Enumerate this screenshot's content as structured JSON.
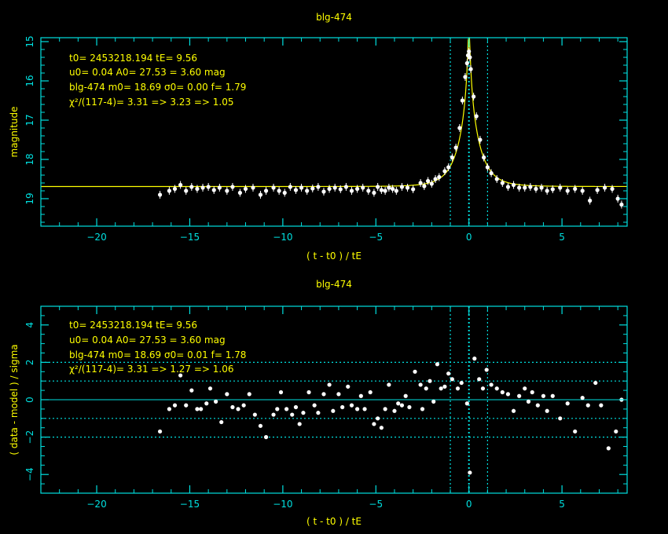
{
  "colors": {
    "axis": "#00e0e0",
    "text": "#ffff00",
    "model": "#ffff00",
    "points": "#ffffff",
    "background": "#000000"
  },
  "chart_data": [
    {
      "type": "scatter",
      "title": "blg-474",
      "xlabel": "( t - t0 ) / tE",
      "ylabel": "magnitude",
      "xlim": [
        -23,
        8.5
      ],
      "ylim": [
        19.7,
        14.9
      ],
      "y_inverted": true,
      "xticks": [
        -20,
        -15,
        -10,
        -5,
        0,
        5
      ],
      "yticks": [
        15,
        16,
        17,
        18,
        19
      ],
      "vlines_dotted": [
        -1,
        0,
        1
      ],
      "annotations": [
        "t0= 2453218.194 tE= 9.56",
        "u0= 0.04 A0= 27.53 = 3.60 mag",
        "blg-474 m0= 18.69 σ0= 0.00 f= 1.79",
        "χ²/(117-4)= 3.31 => 3.23 => 1.05"
      ],
      "model": {
        "t0": 0,
        "tE": 1,
        "u0": 0.04,
        "m0": 18.69,
        "f": 1.79
      },
      "series": [
        {
          "x": [
            -16.6,
            -16.1,
            -15.8,
            -15.5,
            -15.2,
            -14.9,
            -14.6,
            -14.3,
            -14.0,
            -13.7,
            -13.4,
            -13.0,
            -12.7,
            -12.3,
            -12.0,
            -11.6,
            -11.2,
            -10.9,
            -10.5,
            -10.2,
            -9.9,
            -9.6,
            -9.3,
            -9.0,
            -8.7,
            -8.4,
            -8.1,
            -7.8,
            -7.5,
            -7.2,
            -6.9,
            -6.6,
            -6.3,
            -6.0,
            -5.7,
            -5.4,
            -5.1,
            -4.9,
            -4.7,
            -4.5,
            -4.3,
            -4.1,
            -3.9,
            -3.6,
            -3.3,
            -3.0,
            -2.6,
            -2.4,
            -2.2,
            -2.0,
            -1.8,
            -1.6,
            -1.3,
            -1.1,
            -0.9,
            -0.7,
            -0.5,
            -0.35,
            -0.2,
            -0.1,
            -0.05,
            0.0,
            0.05,
            0.1,
            0.25,
            0.4,
            0.6,
            0.8,
            1.0,
            1.2,
            1.5,
            1.8,
            2.1,
            2.4,
            2.7,
            3.0,
            3.3,
            3.6,
            3.9,
            4.2,
            4.5,
            4.9,
            5.3,
            5.7,
            6.1,
            6.5,
            6.9,
            7.3,
            7.7,
            8.0,
            8.2
          ],
          "y": [
            18.9,
            18.8,
            18.75,
            18.65,
            18.8,
            18.7,
            18.75,
            18.72,
            18.7,
            18.78,
            18.72,
            18.8,
            18.7,
            18.85,
            18.75,
            18.72,
            18.9,
            18.8,
            18.72,
            18.8,
            18.85,
            18.7,
            18.78,
            18.72,
            18.8,
            18.74,
            18.7,
            18.82,
            18.75,
            18.72,
            18.76,
            18.7,
            18.8,
            18.75,
            18.72,
            18.8,
            18.85,
            18.7,
            18.78,
            18.8,
            18.72,
            18.75,
            18.8,
            18.7,
            18.72,
            18.76,
            18.6,
            18.68,
            18.55,
            18.62,
            18.5,
            18.45,
            18.3,
            18.2,
            17.95,
            17.7,
            17.2,
            16.5,
            15.9,
            15.55,
            15.35,
            15.25,
            15.4,
            15.7,
            16.4,
            16.9,
            17.5,
            17.95,
            18.2,
            18.35,
            18.5,
            18.6,
            18.7,
            18.65,
            18.72,
            18.72,
            18.7,
            18.75,
            18.72,
            18.8,
            18.76,
            18.72,
            18.8,
            18.75,
            18.8,
            19.05,
            18.78,
            18.72,
            18.75,
            19.0,
            19.15
          ]
        }
      ]
    },
    {
      "type": "scatter",
      "title": "blg-474",
      "xlabel": "( t - t0 ) / tE",
      "ylabel": "( data - model ) / sigma",
      "xlim": [
        -23,
        8.5
      ],
      "ylim": [
        -5,
        5
      ],
      "xticks": [
        -20,
        -15,
        -10,
        -5,
        0,
        5
      ],
      "yticks": [
        -4,
        -2,
        0,
        2,
        4
      ],
      "hlines_solid": [
        0
      ],
      "hlines_dotted": [
        -2,
        -1,
        1,
        2
      ],
      "vlines_dotted": [
        -1,
        0,
        1
      ],
      "annotations": [
        "t0= 2453218.194 tE= 9.56",
        "u0= 0.04 A0= 27.53 = 3.60 mag",
        "blg-474 m0= 18.69 σ0= 0.01 f= 1.78",
        "χ²/(117-4)= 3.31 => 1.27 => 1.06"
      ],
      "series": [
        {
          "x": [
            -16.6,
            -16.1,
            -15.8,
            -15.5,
            -15.2,
            -14.9,
            -14.6,
            -14.4,
            -14.1,
            -13.9,
            -13.6,
            -13.3,
            -13.0,
            -12.7,
            -12.4,
            -12.1,
            -11.8,
            -11.5,
            -11.2,
            -10.9,
            -10.5,
            -10.3,
            -10.1,
            -9.8,
            -9.5,
            -9.3,
            -9.1,
            -8.9,
            -8.6,
            -8.3,
            -8.1,
            -7.8,
            -7.5,
            -7.3,
            -7.0,
            -6.8,
            -6.5,
            -6.3,
            -6.0,
            -5.8,
            -5.6,
            -5.3,
            -5.1,
            -4.9,
            -4.7,
            -4.5,
            -4.3,
            -4.0,
            -3.8,
            -3.6,
            -3.4,
            -3.2,
            -2.9,
            -2.6,
            -2.5,
            -2.3,
            -2.1,
            -1.9,
            -1.7,
            -1.5,
            -1.3,
            -1.1,
            -0.9,
            -0.6,
            -0.4,
            -0.1,
            0.05,
            0.3,
            0.55,
            0.75,
            0.95,
            1.2,
            1.5,
            1.8,
            2.1,
            2.4,
            2.7,
            3.0,
            3.2,
            3.4,
            3.7,
            4.0,
            4.2,
            4.5,
            4.9,
            5.3,
            5.7,
            6.1,
            6.4,
            6.8,
            7.1,
            7.5,
            7.9,
            8.2
          ],
          "y": [
            -1.7,
            -0.5,
            -0.3,
            1.3,
            -0.3,
            0.5,
            -0.5,
            -0.5,
            -0.2,
            0.6,
            -0.1,
            -1.2,
            0.3,
            -0.4,
            -0.5,
            -0.3,
            0.3,
            -0.8,
            -1.4,
            -2.0,
            -0.8,
            -0.5,
            0.4,
            -0.5,
            -0.8,
            -0.4,
            -1.3,
            -0.7,
            0.4,
            -0.3,
            -0.7,
            0.3,
            0.8,
            -0.6,
            0.3,
            -0.4,
            0.7,
            -0.3,
            -0.5,
            0.2,
            -0.5,
            0.4,
            -1.3,
            -1.0,
            -1.5,
            -0.5,
            0.8,
            -0.6,
            -0.2,
            -0.3,
            0.2,
            -0.4,
            1.5,
            0.8,
            -0.5,
            0.6,
            1.0,
            -0.1,
            1.9,
            0.6,
            0.7,
            1.4,
            1.1,
            0.6,
            0.9,
            -0.2,
            -3.9,
            2.2,
            1.1,
            0.6,
            1.6,
            0.8,
            0.6,
            0.4,
            0.3,
            -0.6,
            0.2,
            0.6,
            -0.1,
            0.4,
            -0.3,
            0.2,
            -0.6,
            0.2,
            -1.0,
            -0.2,
            -1.7,
            0.1,
            -0.3,
            0.9,
            -0.3,
            -2.6,
            -1.7,
            0.0
          ]
        }
      ]
    }
  ]
}
